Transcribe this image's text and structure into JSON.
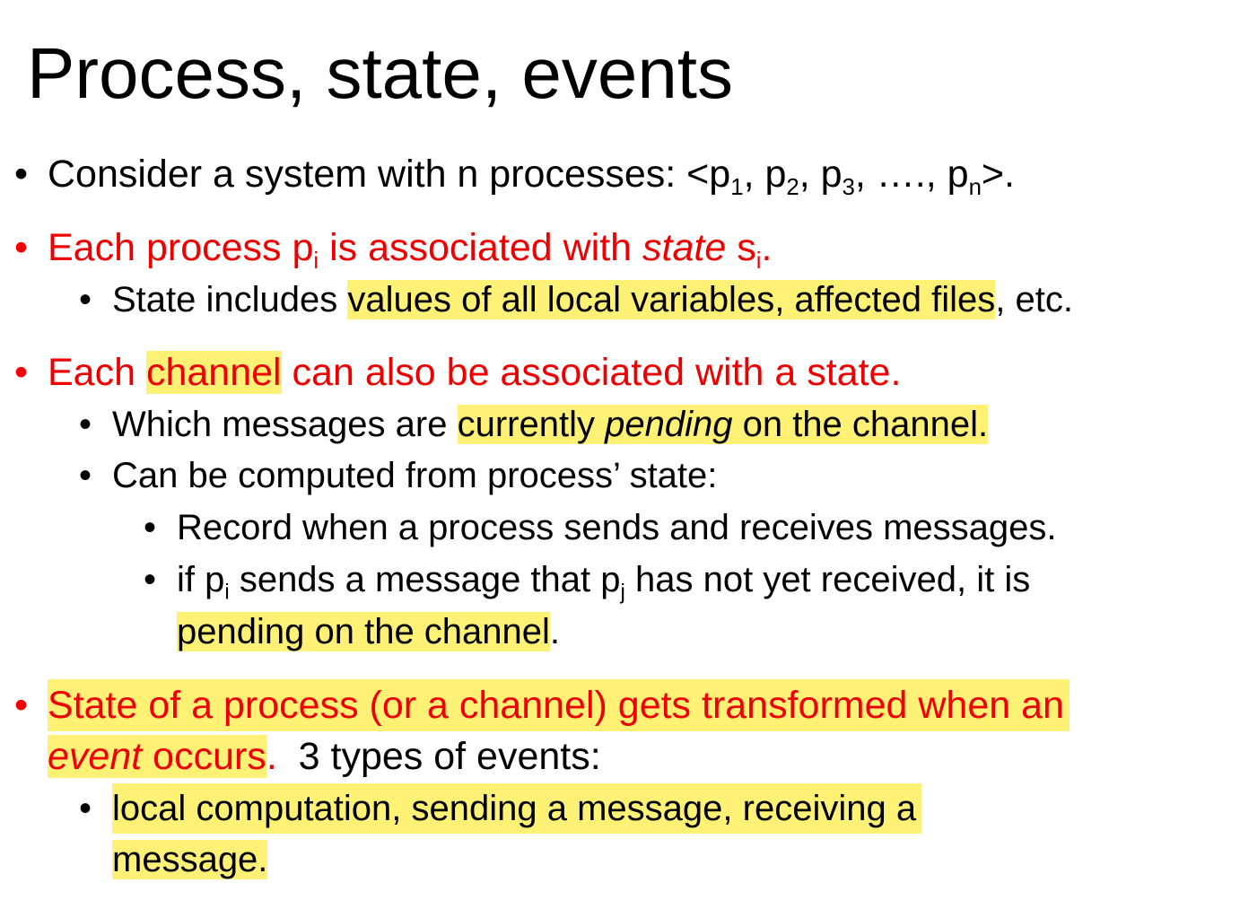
{
  "slide": {
    "title": "Process, state, events",
    "bullet": "•",
    "b1": {
      "a": "Consider a system with n processes: <p",
      "s1": "1",
      "b": ", p",
      "s2": "2",
      "c": ", p",
      "s3": "3",
      "d": ", …., p",
      "sn": "n",
      "e": ">."
    },
    "b2": {
      "a": "Each process p",
      "si": "i",
      "b": " is associated with ",
      "state_word": "state",
      "c": " s",
      "si2": "i",
      "d": ".",
      "sub1": {
        "a": "State includes ",
        "hl": "values of all local variables, affected files",
        "b": ", etc."
      }
    },
    "b3": {
      "a": "Each ",
      "channel": "channel",
      "b": " can also be associated with a state.",
      "sub1": {
        "a": "Which messages are ",
        "hl_a": "currently ",
        "pending": "pending",
        "hl_b": " on the channel."
      },
      "sub2": "Can be computed from process’ state:",
      "sub2a": "Record when a process sends and receives messages.",
      "sub2b": {
        "a": "if p",
        "si": "i",
        "b": " sends a message that p",
        "sj": "j",
        "c": " has not yet received, it is",
        "hl": "pending on the channel",
        "d": "."
      }
    },
    "b4": {
      "line1": "State of a process (or a channel) gets transformed when an",
      "event": "event",
      "occurs": " occurs",
      "dot": ".",
      "rest": "  3 types of events:",
      "sub1_line1": "local computation, sending a message, receiving a",
      "sub1_line2": "message."
    }
  }
}
